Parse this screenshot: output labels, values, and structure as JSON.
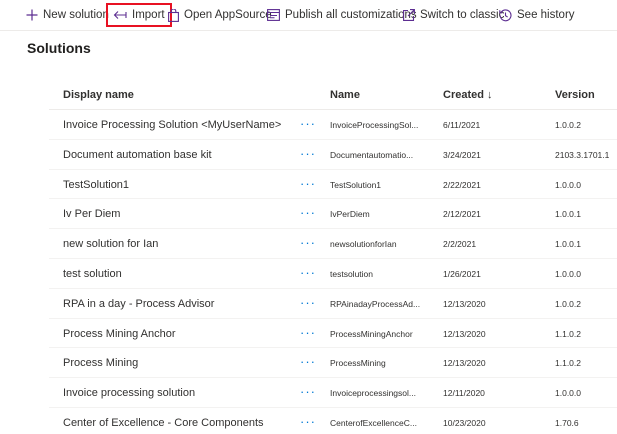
{
  "toolbar": {
    "new_solution": "New solution",
    "import": "Import",
    "open_appsource": "Open AppSource",
    "publish_all": "Publish all customizations",
    "switch_classic": "Switch to classic",
    "see_history": "See history"
  },
  "page_title": "Solutions",
  "columns": {
    "display_name": "Display name",
    "name": "Name",
    "created": "Created",
    "sort_indicator": "↓",
    "version": "Version"
  },
  "more_glyph": "···",
  "rows": [
    {
      "display": "Invoice Processing Solution <MyUserName>",
      "name": "InvoiceProcessingSol...",
      "created": "6/11/2021",
      "version": "1.0.0.2"
    },
    {
      "display": "Document automation base kit",
      "name": "Documentautomatio...",
      "created": "3/24/2021",
      "version": "2103.3.1701.1"
    },
    {
      "display": "TestSolution1",
      "name": "TestSolution1",
      "created": "2/22/2021",
      "version": "1.0.0.0"
    },
    {
      "display": "Iv Per Diem",
      "name": "IvPerDiem",
      "created": "2/12/2021",
      "version": "1.0.0.1"
    },
    {
      "display": "new solution for Ian",
      "name": "newsolutionforIan",
      "created": "2/2/2021",
      "version": "1.0.0.1"
    },
    {
      "display": "test solution",
      "name": "testsolution",
      "created": "1/26/2021",
      "version": "1.0.0.0"
    },
    {
      "display": "RPA in a day - Process Advisor",
      "name": "RPAinadayProcessAd...",
      "created": "12/13/2020",
      "version": "1.0.0.2"
    },
    {
      "display": "Process Mining Anchor",
      "name": "ProcessMiningAnchor",
      "created": "12/13/2020",
      "version": "1.1.0.2"
    },
    {
      "display": "Process Mining",
      "name": "ProcessMining",
      "created": "12/13/2020",
      "version": "1.1.0.2"
    },
    {
      "display": "Invoice processing solution",
      "name": "Invoiceprocessingsol...",
      "created": "12/11/2020",
      "version": "1.0.0.0"
    },
    {
      "display": "Center of Excellence - Core Components",
      "name": "CenterofExcellenceC...",
      "created": "10/23/2020",
      "version": "1.70.6"
    }
  ]
}
